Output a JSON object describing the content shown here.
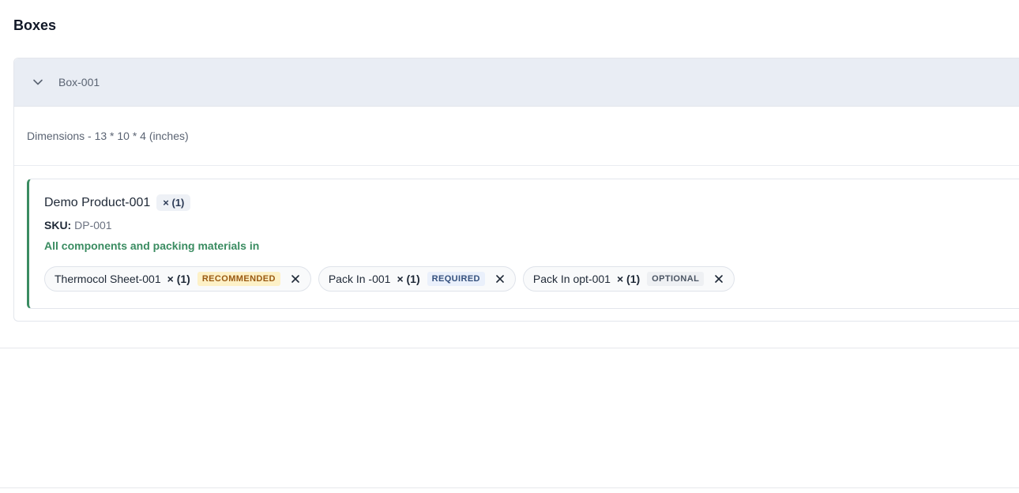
{
  "section": {
    "title": "Boxes"
  },
  "box": {
    "name": "Box-001",
    "chevron_icon": "chevron-down-icon",
    "dimensions": "Dimensions - 13 * 10 * 4 (inches)"
  },
  "product": {
    "name": "Demo Product-001",
    "qty": "× (1)",
    "sku_label": "SKU:",
    "sku_value": "DP-001",
    "status": "All components and packing materials in",
    "accent_color": "#3a8c61",
    "components": [
      {
        "name": "Thermocol Sheet-001",
        "qty": "× (1)",
        "tag": "RECOMMENDED",
        "tag_color": "#9a5a12",
        "close_icon": "close-icon"
      },
      {
        "name": "Pack In -001",
        "qty": "× (1)",
        "tag": "REQUIRED",
        "tag_color": "#34507d",
        "close_icon": "close-icon"
      },
      {
        "name": "Pack In opt-001",
        "qty": "× (1)",
        "tag": "OPTIONAL",
        "tag_color": "#4b5563",
        "close_icon": "close-icon"
      }
    ]
  }
}
